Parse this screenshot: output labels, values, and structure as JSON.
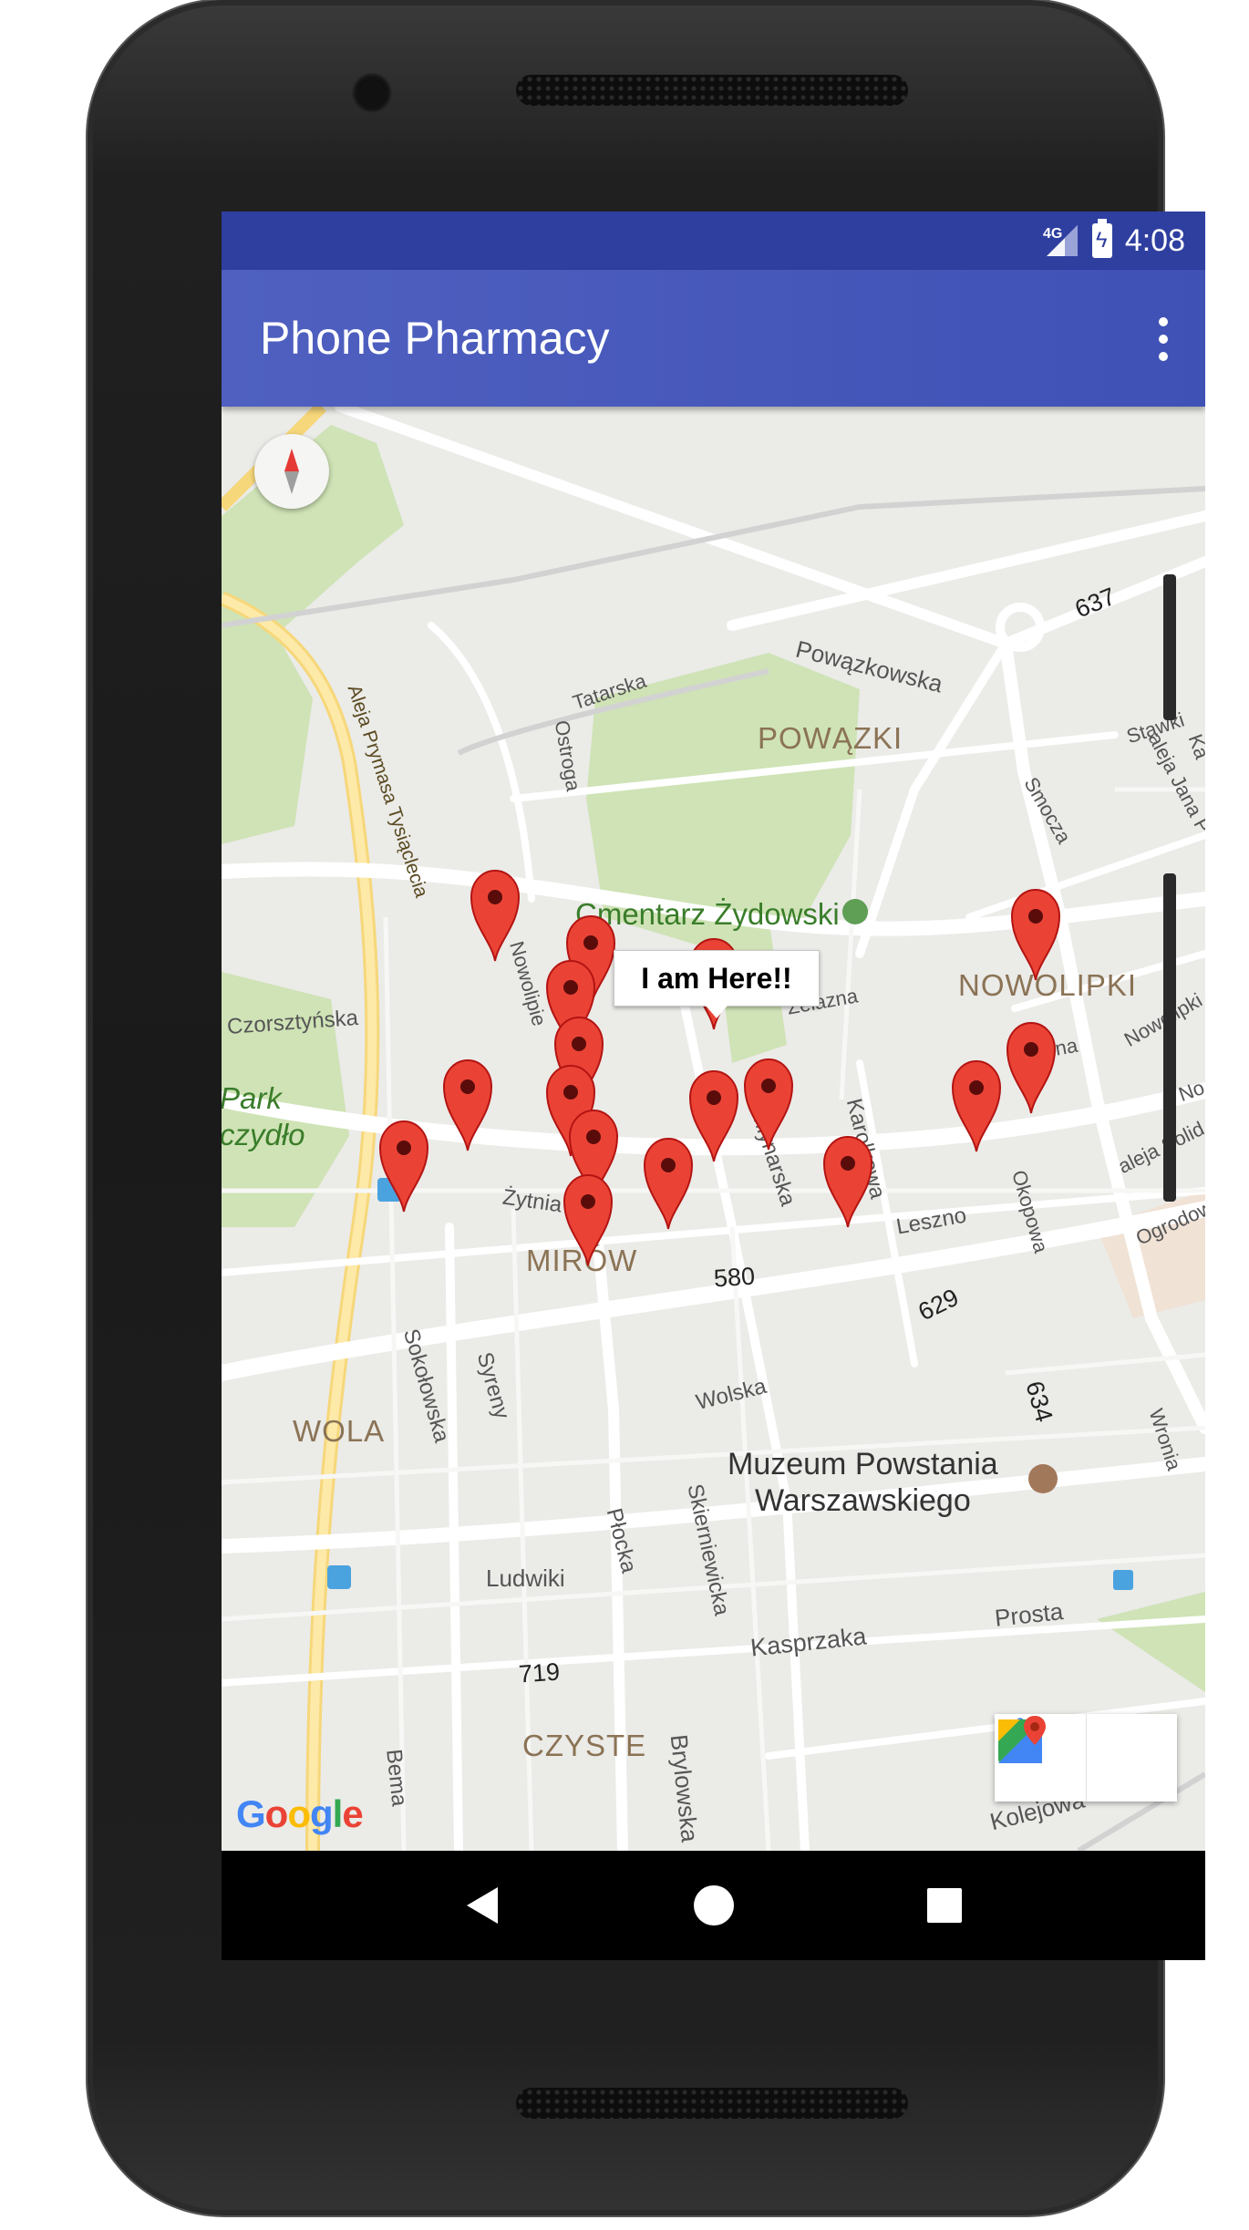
{
  "status_bar": {
    "network": "4G",
    "time": "4:08"
  },
  "app_bar": {
    "title": "Phone Pharmacy",
    "overflow_icon": "more-vert-icon"
  },
  "map": {
    "info_window": "I am Here!!",
    "districts": [
      "POWĄZKI",
      "NOWOLIPKI",
      "MIRÓW",
      "WOLA",
      "CZYSTE"
    ],
    "green_labels": [
      "Cmentarz Żydowski",
      "Park",
      "czydło"
    ],
    "poi": [
      "Muzeum Powstania",
      "Warszawskiego"
    ],
    "streets": [
      "Powązkowska",
      "Tatarska",
      "Ostroga",
      "Aleja Prymasa Tysiąclecia",
      "Smocza",
      "Stawki",
      "aleja Jana P",
      "Czorsztyńska",
      "Nowolipki",
      "Karolkowa",
      "Młynarska",
      "Żytnia",
      "Leszno",
      "aleja Solid",
      "Ogrodowa",
      "Wolska",
      "Sokołowska",
      "Syreny",
      "Płocka",
      "Skierniewicka",
      "Wronia",
      "Ludwiki",
      "Kasprzaka",
      "Prosta",
      "Brylowska",
      "Bema",
      "Kolejowa",
      "Żelazna",
      "Nowolipie",
      "Okopowa",
      "Dzielna",
      "No",
      "Ka"
    ],
    "route_numbers": [
      "637",
      "580",
      "629",
      "634",
      "719"
    ],
    "attribution": "Google",
    "compass_icon": "compass-icon",
    "directions_icon": "directions-icon",
    "open_maps_icon": "google-maps-icon",
    "marker_count": 17,
    "colors": {
      "marker": "#ea4335",
      "park": "#c8dfb0",
      "road": "#ffffff",
      "highway": "#fde293",
      "app_bar": "#3f51b5",
      "status_bar": "#2f3fa0"
    }
  },
  "nav_bar": {
    "back_icon": "back-icon",
    "home_icon": "home-icon",
    "recents_icon": "recents-icon"
  }
}
